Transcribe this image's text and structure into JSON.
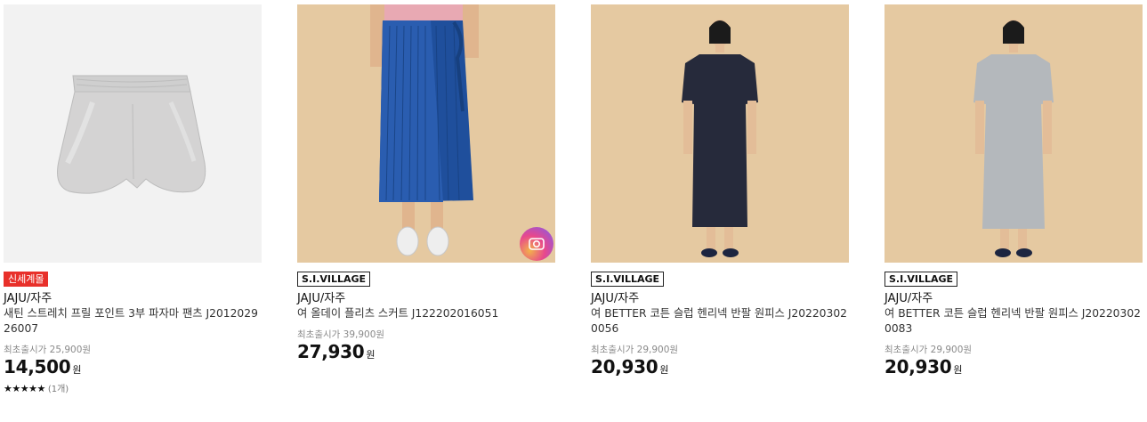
{
  "products": [
    {
      "badge": "신세계몰",
      "brand": "JAJU/자주",
      "name": "새틴 스트레치 프릴 포인트 3부 파자마 팬츠 J201202926007",
      "original_label": "최초출시가 25,900원",
      "price": "14,500",
      "currency": "원",
      "stars": "★★★★★",
      "review_count": "(1개)",
      "rating": 5
    },
    {
      "badge": "S.I.VILLAGE",
      "brand": "JAJU/자주",
      "name": "여 올데이 플리츠 스커트 J122202016051",
      "original_label": "최초출시가 39,900원",
      "price": "27,930",
      "currency": "원"
    },
    {
      "badge": "S.I.VILLAGE",
      "brand": "JAJU/자주",
      "name": "여 BETTER 코튼 슬럽 헨리넥 반팔 원피스 J202203020056",
      "original_label": "최초출시가 29,900원",
      "price": "20,930",
      "currency": "원"
    },
    {
      "badge": "S.I.VILLAGE",
      "brand": "JAJU/자주",
      "name": "여 BETTER 코튼 슬럽 헨리넥 반팔 원피스 J202203020083",
      "original_label": "최초출시가 29,900원",
      "price": "20,930",
      "currency": "원"
    }
  ],
  "colors": {
    "badge_red": "#e8302a",
    "photo_background": "#e5c9a1",
    "skirt_blue": "#1f4f9c",
    "navy_dress": "#262a3b",
    "gray_dress": "#b4b8bc"
  },
  "icons": [
    "photo-review-camera-icon"
  ]
}
